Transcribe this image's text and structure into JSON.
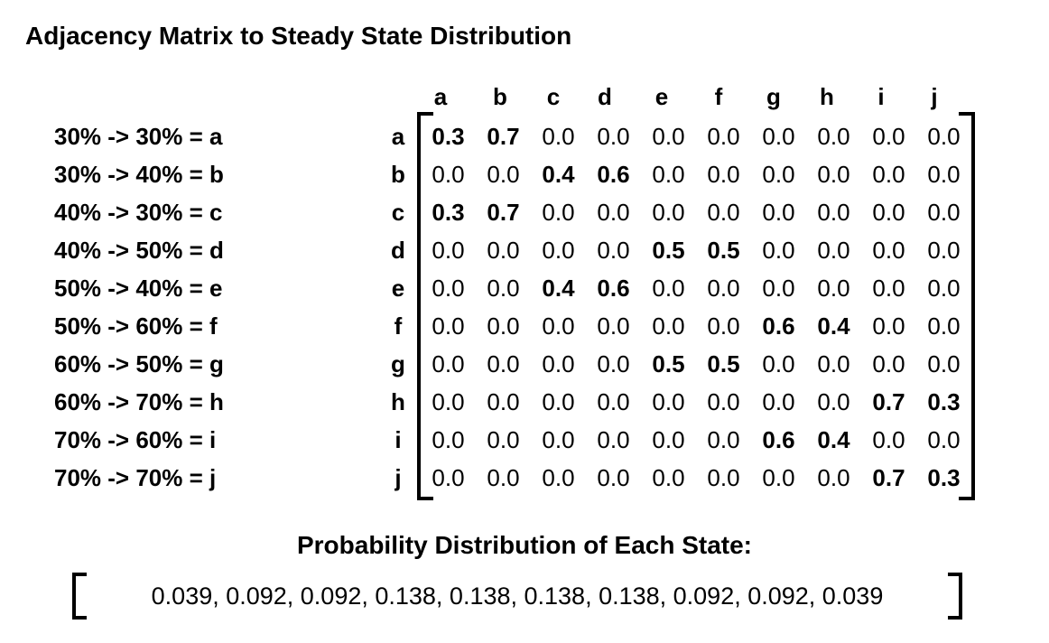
{
  "title": "Adjacency Matrix to Steady State Distribution",
  "states": [
    "30% -> 30% = a",
    "30% -> 40% = b",
    "40% -> 30% = c",
    "40% -> 50% = d",
    "50% -> 40% = e",
    "50% -> 60% = f",
    "60% -> 50% = g",
    "60% -> 70% = h",
    "70% -> 60% = i",
    "70% -> 70% = j"
  ],
  "matrix": {
    "col_labels": [
      "a",
      "b",
      "c",
      "d",
      "e",
      "f",
      "g",
      "h",
      "i",
      "j"
    ],
    "row_labels": [
      "a",
      "b",
      "c",
      "d",
      "e",
      "f",
      "g",
      "h",
      "i",
      "j"
    ],
    "rows": [
      [
        "0.3",
        "0.7",
        "0.0",
        "0.0",
        "0.0",
        "0.0",
        "0.0",
        "0.0",
        "0.0",
        "0.0"
      ],
      [
        "0.0",
        "0.0",
        "0.4",
        "0.6",
        "0.0",
        "0.0",
        "0.0",
        "0.0",
        "0.0",
        "0.0"
      ],
      [
        "0.3",
        "0.7",
        "0.0",
        "0.0",
        "0.0",
        "0.0",
        "0.0",
        "0.0",
        "0.0",
        "0.0"
      ],
      [
        "0.0",
        "0.0",
        "0.0",
        "0.0",
        "0.5",
        "0.5",
        "0.0",
        "0.0",
        "0.0",
        "0.0"
      ],
      [
        "0.0",
        "0.0",
        "0.4",
        "0.6",
        "0.0",
        "0.0",
        "0.0",
        "0.0",
        "0.0",
        "0.0"
      ],
      [
        "0.0",
        "0.0",
        "0.0",
        "0.0",
        "0.0",
        "0.0",
        "0.6",
        "0.4",
        "0.0",
        "0.0"
      ],
      [
        "0.0",
        "0.0",
        "0.0",
        "0.0",
        "0.5",
        "0.5",
        "0.0",
        "0.0",
        "0.0",
        "0.0"
      ],
      [
        "0.0",
        "0.0",
        "0.0",
        "0.0",
        "0.0",
        "0.0",
        "0.0",
        "0.0",
        "0.7",
        "0.3"
      ],
      [
        "0.0",
        "0.0",
        "0.0",
        "0.0",
        "0.0",
        "0.0",
        "0.6",
        "0.4",
        "0.0",
        "0.0"
      ],
      [
        "0.0",
        "0.0",
        "0.0",
        "0.0",
        "0.0",
        "0.0",
        "0.0",
        "0.0",
        "0.7",
        "0.3"
      ]
    ]
  },
  "distribution": {
    "title": "Probability Distribution of Each State:",
    "vector_text": "0.039, 0.092, 0.092, 0.138, 0.138, 0.138, 0.138, 0.092, 0.092, 0.039"
  }
}
